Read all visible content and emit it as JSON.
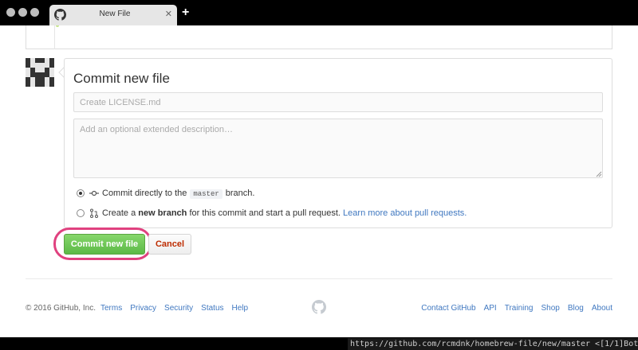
{
  "window": {
    "tab_title": "New File",
    "tab_close": "✕",
    "new_tab": "+"
  },
  "commit": {
    "heading": "Commit new file",
    "summary_placeholder": "Create LICENSE.md",
    "description_placeholder": "Add an optional extended description…",
    "option_direct": {
      "prefix": "Commit directly to the",
      "branch": "master",
      "suffix": "branch.",
      "selected": true
    },
    "option_branch": {
      "prefix": "Create a",
      "bold": "new branch",
      "middle": "for this commit and start a pull request.",
      "link": "Learn more about pull requests.",
      "selected": false
    },
    "commit_button": "Commit new file",
    "cancel_button": "Cancel"
  },
  "footer": {
    "copyright": "© 2016 GitHub, Inc.",
    "left_links": [
      "Terms",
      "Privacy",
      "Security",
      "Status",
      "Help"
    ],
    "right_links": [
      "Contact GitHub",
      "API",
      "Training",
      "Shop",
      "Blog",
      "About"
    ]
  },
  "statusbar": {
    "url": "https://github.com/rcmdnk/homebrew-file/new/master <[1/1]Bot"
  },
  "colors": {
    "commit_button": "#5cb947",
    "highlight_ring": "#e0417f",
    "link": "#4078c0",
    "cancel_text": "#bd2c00"
  },
  "icons": {
    "tab": "github-octocat-icon",
    "direct_commit": "git-commit-icon",
    "new_branch": "git-pull-request-icon",
    "footer_logo": "github-octocat-icon",
    "avatar": "identicon-avatar"
  }
}
